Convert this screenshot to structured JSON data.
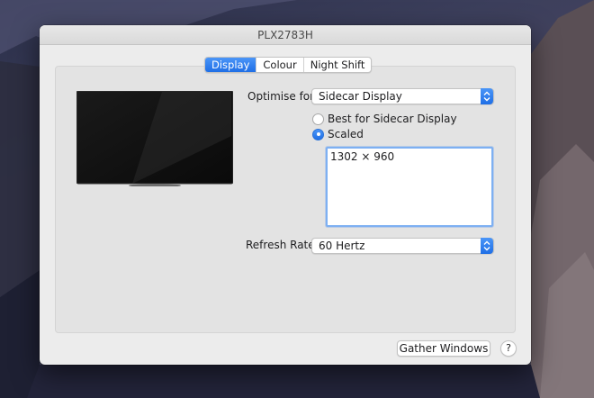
{
  "window": {
    "title": "PLX2783H"
  },
  "tabs": [
    {
      "label": "Display",
      "active": true
    },
    {
      "label": "Colour",
      "active": false
    },
    {
      "label": "Night Shift",
      "active": false
    }
  ],
  "optimise": {
    "label": "Optimise for:",
    "value": "Sidecar Display"
  },
  "resolution": {
    "options": [
      {
        "label": "Best for Sidecar Display",
        "checked": false
      },
      {
        "label": "Scaled",
        "checked": true
      }
    ],
    "scaled_list": [
      "1302 × 960"
    ]
  },
  "refresh": {
    "label": "Refresh Rate:",
    "value": "60 Hertz"
  },
  "footer": {
    "gather_label": "Gather Windows",
    "help_label": "?"
  },
  "colors": {
    "accent": "#1f6fe6",
    "window_bg": "#ececec"
  },
  "icons": {
    "monitor": "display-preview-icon",
    "stepper": "popup-stepper-icon"
  }
}
